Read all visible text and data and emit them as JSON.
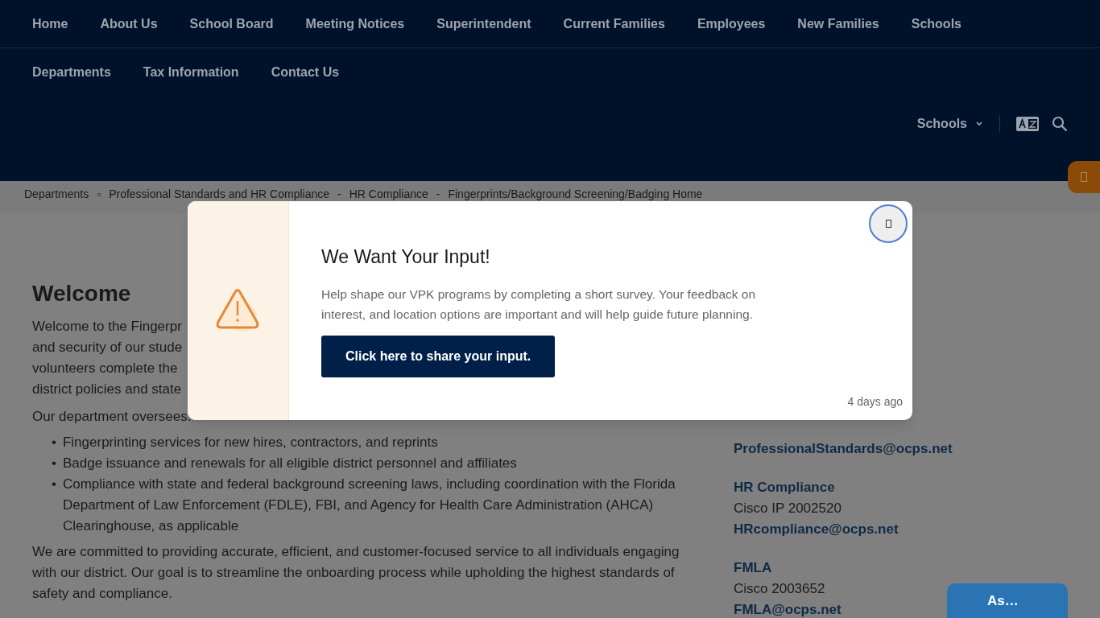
{
  "nav": {
    "row_1": [
      "Home",
      "About Us",
      "School Board",
      "Meeting Notices",
      "Superintendent",
      "Current Families",
      "Employees",
      "New Families",
      "Schools"
    ],
    "row_2": [
      "Departments",
      "Tax Information",
      "Contact Us"
    ],
    "schools_dropdown": "Schools"
  },
  "breadcrumbs": [
    {
      "label": "Departments",
      "separator": "▫"
    },
    {
      "label": "Professional Standards and HR Compliance",
      "separator": "-"
    },
    {
      "label": "HR Compliance",
      "separator": "-"
    },
    {
      "label": "Fingerprints/Background Screening/Badging Home"
    }
  ],
  "main": {
    "heading": "Welcome",
    "intro_lines": [
      "Welcome to the Fingerpr",
      "and security of our stude",
      "volunteers complete the",
      "district policies and state"
    ],
    "oversees": "Our department oversees:",
    "bullets": [
      {
        "marker": "•",
        "text": "Fingerprinting services for new hires, contractors, and reprints"
      },
      {
        "marker": "•",
        "text": "Badge issuance and renewals for all eligible district personnel and affiliates"
      },
      {
        "marker": "•",
        "text": "Compliance with state and federal background screening laws, including coordination with the Florida Department of Law Enforcement (FDLE), FBI, and Agency for Health Care Administration (AHCA) Clearinghouse, as applicable"
      }
    ],
    "closing": "We are committed to providing accurate, efficient, and customer-focused service to all individuals engaging with our district. Our goal is to streamline the onboarding process while upholding the highest standards of safety and compliance."
  },
  "contacts": [
    {
      "email": "ProfessionalStandards@ocps.net"
    },
    {
      "title": "HR Compliance",
      "phone": "Cisco IP 2002520",
      "email": "HRcompliance@ocps.net"
    },
    {
      "title": "FMLA",
      "phone": "Cisco 2003652",
      "email": "FMLA@ocps.net"
    }
  ],
  "modal": {
    "title": "We Want Your Input!",
    "body": "Help shape our VPK programs by completing a short survey. Your feedback on interest, and location options are important and will help guide future planning.",
    "button": "Click here to share your input.",
    "time": "4 days ago"
  },
  "chat_button": "As…"
}
